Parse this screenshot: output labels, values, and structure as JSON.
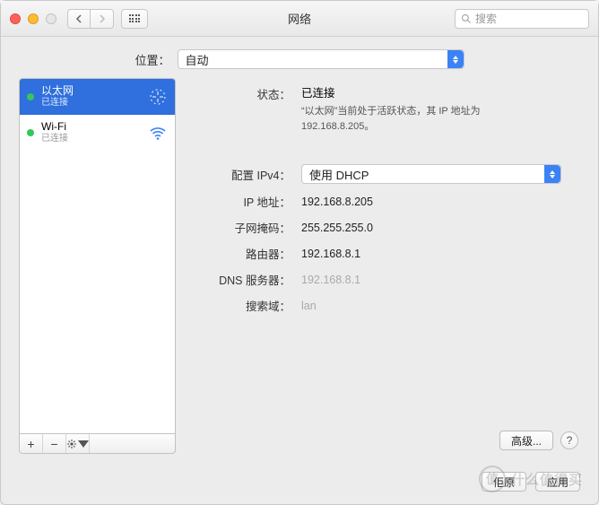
{
  "window": {
    "title": "网络"
  },
  "toolbar": {
    "search_placeholder": "搜索"
  },
  "location": {
    "label": "位置：",
    "value": "自动"
  },
  "sidebar": {
    "items": [
      {
        "name": "以太网",
        "status": "已连接",
        "kind": "ethernet",
        "active": true
      },
      {
        "name": "Wi-Fi",
        "status": "已连接",
        "kind": "wifi",
        "active": false
      }
    ]
  },
  "detail": {
    "status_label": "状态：",
    "status_value": "已连接",
    "status_desc": "“以太网”当前处于活跃状态，其 IP 地址为 192.168.8.205。",
    "config_ipv4_label": "配置 IPv4：",
    "config_ipv4_value": "使用 DHCP",
    "ip_label": "IP 地址：",
    "ip_value": "192.168.8.205",
    "mask_label": "子网掩码：",
    "mask_value": "255.255.255.0",
    "router_label": "路由器：",
    "router_value": "192.168.8.1",
    "dns_label": "DNS 服务器：",
    "dns_value": "192.168.8.1",
    "search_domain_label": "搜索域：",
    "search_domain_value": "lan",
    "advanced_button": "高级..."
  },
  "footer": {
    "revert": "佢原",
    "apply": "应用"
  },
  "watermark": {
    "badge": "值",
    "text": "什么值得买"
  }
}
